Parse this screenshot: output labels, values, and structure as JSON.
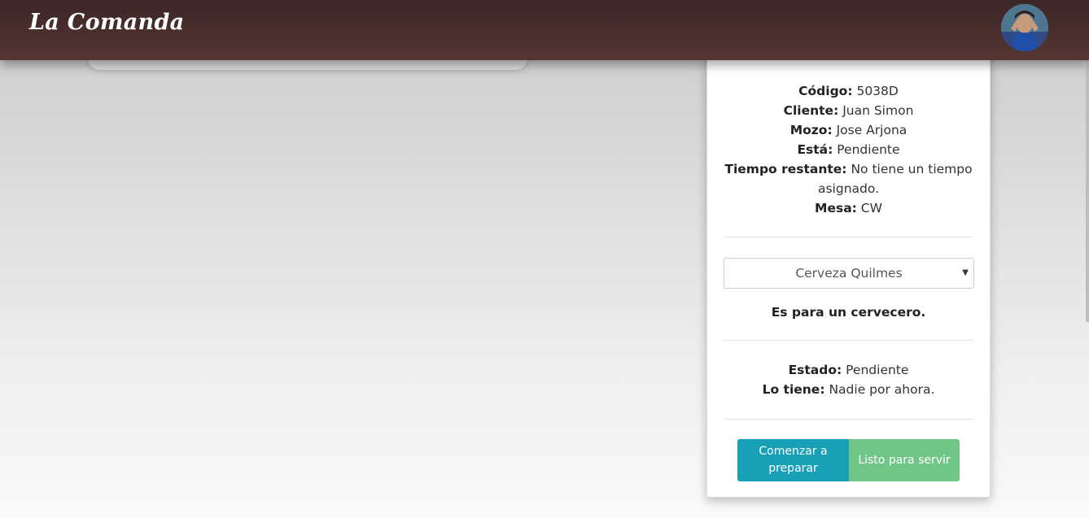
{
  "navbar": {
    "brand": "La Comanda",
    "avatar_label": "user-avatar"
  },
  "order": {
    "code_label": "Código:",
    "code_value": "5038D",
    "client_label": "Cliente:",
    "client_value": "Juan Simon",
    "waiter_label": "Mozo:",
    "waiter_value": "Jose Arjona",
    "state_label": "Está:",
    "state_value": "Pendiente",
    "time_label": "Tiempo restante:",
    "time_value": "No tiene un tiempo asignado.",
    "table_label": "Mesa:",
    "table_value": "CW"
  },
  "product": {
    "selected": "Cerveza Quilmes",
    "for_text": "Es para un cervecero."
  },
  "item_status": {
    "status_label": "Estado:",
    "status_value": "Pendiente",
    "holder_label": "Lo tiene:",
    "holder_value": "Nadie por ahora."
  },
  "actions": {
    "start_label": "Comenzar a preparar",
    "ready_label": "Listo para servir"
  },
  "colors": {
    "navbar_top": "#3c2626",
    "navbar_bottom": "#553633",
    "start_button": "#18a0b6",
    "ready_button": "#6fc686"
  }
}
